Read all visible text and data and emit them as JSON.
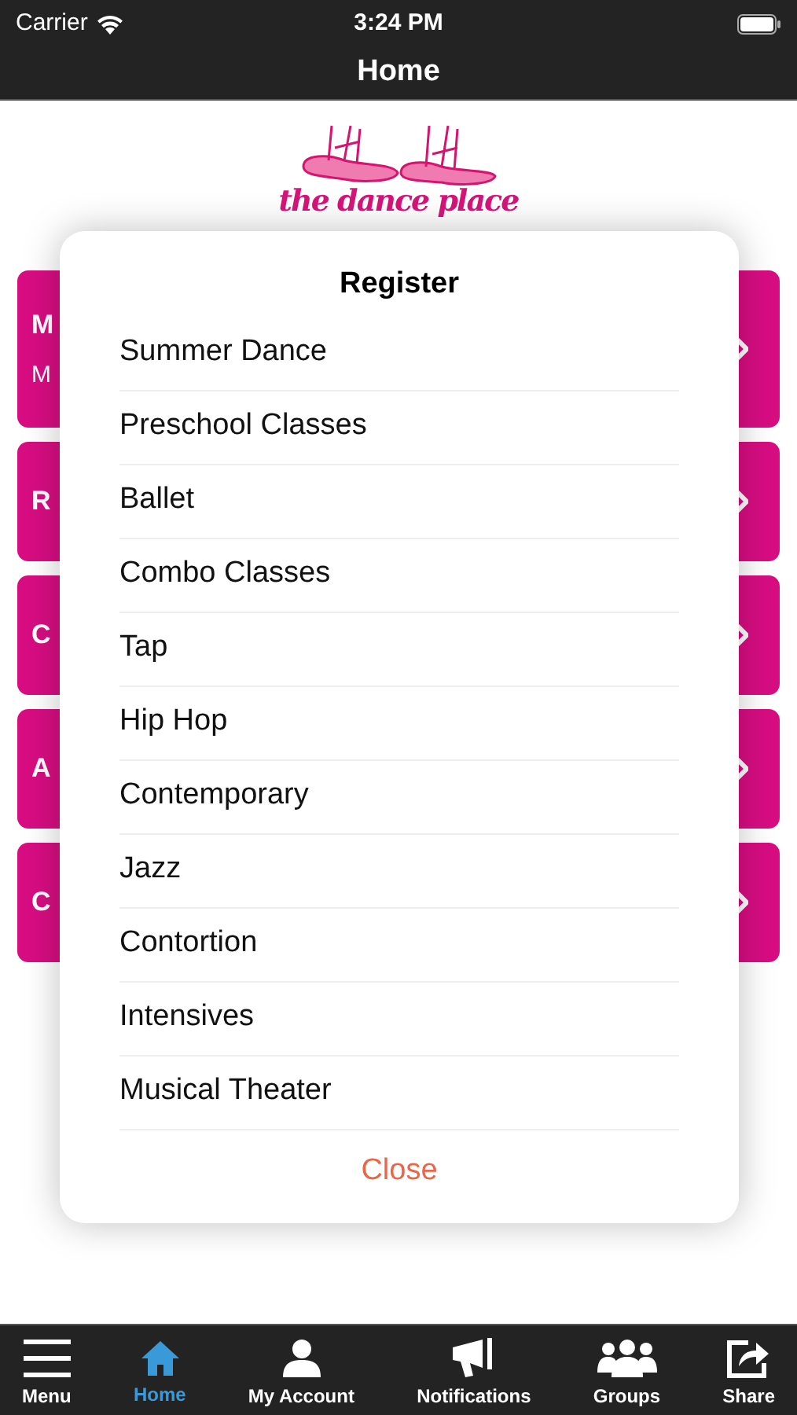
{
  "status_bar": {
    "carrier": "Carrier",
    "time": "3:24 PM"
  },
  "nav_bar": {
    "title": "Home"
  },
  "logo": {
    "text": "the dance place"
  },
  "cards": [
    {
      "title": "M",
      "subtitle": "M"
    },
    {
      "title": "R"
    },
    {
      "title": "C"
    },
    {
      "title": "A"
    },
    {
      "title": "C"
    }
  ],
  "dialog": {
    "title": "Register",
    "items": [
      "Summer Dance",
      "Preschool Classes",
      "Ballet",
      "Combo Classes",
      "Tap",
      "Hip Hop",
      "Contemporary",
      "Jazz",
      "Contortion",
      "Intensives",
      "Musical Theater"
    ],
    "close": "Close"
  },
  "tab_bar": [
    {
      "label": "Menu",
      "kind": "menu",
      "selected": false
    },
    {
      "label": "Home",
      "kind": "home",
      "selected": true
    },
    {
      "label": "My Account",
      "kind": "user",
      "selected": false
    },
    {
      "label": "Notifications",
      "kind": "megaphone",
      "selected": false
    },
    {
      "label": "Groups",
      "kind": "users",
      "selected": false
    },
    {
      "label": "Share",
      "kind": "share",
      "selected": false
    }
  ]
}
